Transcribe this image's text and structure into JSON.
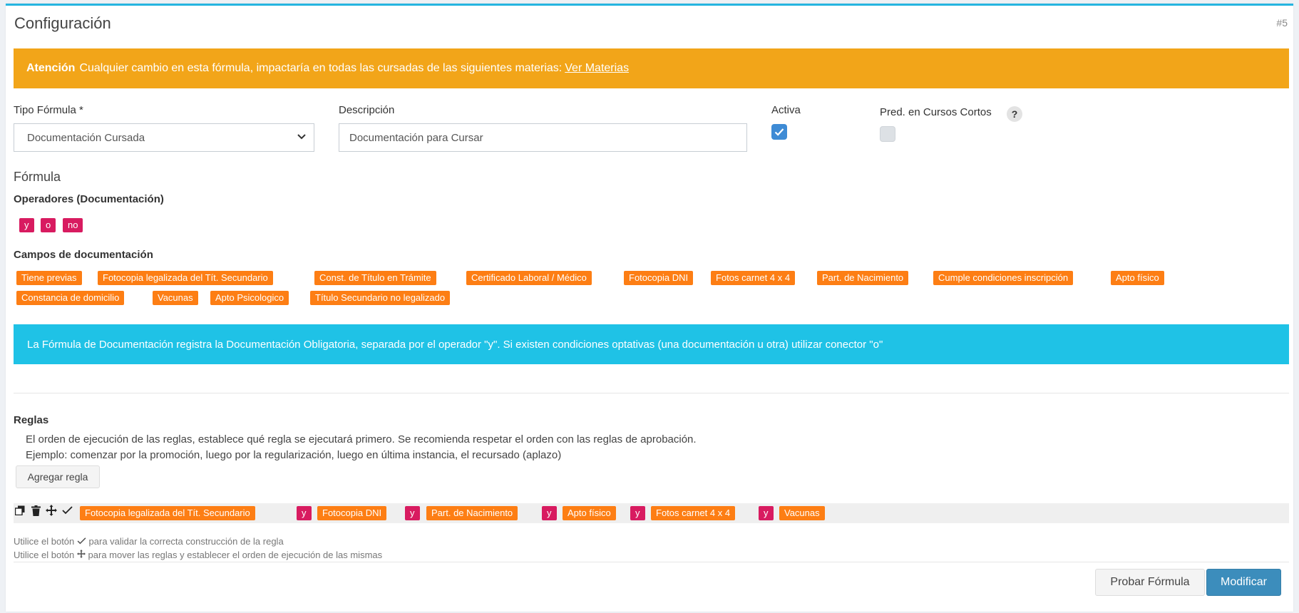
{
  "card": {
    "title": "Configuración",
    "id_label": "#5"
  },
  "alert": {
    "strong": "Atención",
    "text": "Cualquier cambio en esta fórmula, impactaría en todas las cursadas de las siguientes materias:",
    "link": "Ver Materias"
  },
  "form": {
    "tipo_label": "Tipo Fórmula *",
    "tipo_value": "Documentación Cursada",
    "desc_label": "Descripción",
    "desc_value": "Documentación para Cursar",
    "activa_label": "Activa",
    "activa_checked": true,
    "pred_label": "Pred. en Cursos Cortos",
    "pred_checked": false,
    "help": "?"
  },
  "formula": {
    "title": "Fórmula",
    "operadores_label": "Operadores (Documentación)",
    "operadores": [
      "y",
      "o",
      "no"
    ],
    "campos_label": "Campos de documentación",
    "campos": [
      "Tiene previas",
      "Fotocopia legalizada del Tít. Secundario",
      "Const. de Título en Trámite",
      "Certificado Laboral / Médico",
      "Fotocopia DNI",
      "Fotos carnet 4 x 4",
      "Part. de Nacimiento",
      "Cumple condiciones inscripción",
      "Apto físico",
      "Constancia de domicilio",
      "Vacunas",
      "Apto Psicologico",
      "Título Secundario no legalizado"
    ]
  },
  "info": {
    "text": "La Fórmula de Documentación registra la Documentación Obligatoria, separada por el operador \"y\". Si existen condiciones optativas (una documentación u otra) utilizar conector \"o\""
  },
  "reglas": {
    "title": "Reglas",
    "line1": "El orden de ejecución de las reglas, establece qué regla se ejecutará primero. Se recomienda respetar el orden con las reglas de aprobación.",
    "line2": "Ejemplo: comenzar por la promoción, luego por la regularización, luego en última instancia, el recursado (aplazo)",
    "add_button": "Agregar regla",
    "rule": [
      {
        "type": "doc",
        "text": "Fotocopia legalizada del Tít. Secundario"
      },
      {
        "type": "op",
        "text": "y"
      },
      {
        "type": "doc",
        "text": "Fotocopia DNI"
      },
      {
        "type": "op",
        "text": "y"
      },
      {
        "type": "doc",
        "text": "Part. de Nacimiento"
      },
      {
        "type": "op",
        "text": "y"
      },
      {
        "type": "doc",
        "text": "Apto físico"
      },
      {
        "type": "op",
        "text": "y"
      },
      {
        "type": "doc",
        "text": "Fotos carnet 4 x 4"
      },
      {
        "type": "op",
        "text": "y"
      },
      {
        "type": "doc",
        "text": "Vacunas"
      }
    ],
    "note1_pre": "Utilice el botón",
    "note1_post": "para validar la correcta construcción de la regla",
    "note2_pre": "Utilice el botón",
    "note2_post": "para mover las reglas y establecer el orden de ejecución de las mismas"
  },
  "footer": {
    "test_button": "Probar Fórmula",
    "submit_button": "Modificar"
  },
  "colors": {
    "warning": "#f2a519",
    "info": "#1fc2e6",
    "operator": "#d81b60",
    "field": "#fd7e14",
    "primary": "#3c8dbc",
    "accent": "#26b5e0"
  },
  "icons": [
    "chevron-down-icon",
    "check-icon",
    "copy-icon",
    "trash-icon",
    "move-icon",
    "validate-icon"
  ]
}
